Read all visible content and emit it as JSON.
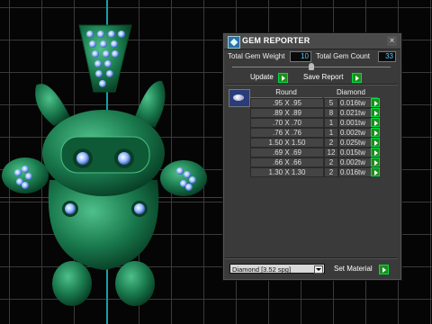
{
  "panel": {
    "title": "GEM REPORTER",
    "close_glyph": "×",
    "total_weight_label": "Total Gem Weight",
    "total_weight_value": "10",
    "total_count_label": "Total Gem Count",
    "total_count_value": "33",
    "update_label": "Update",
    "save_report_label": "Save Report",
    "slider_level": 0.5,
    "table": {
      "headers": [
        "Round",
        "Diamond"
      ],
      "rows": [
        {
          "size": ".95 X .95",
          "count": "5",
          "tw": "0.016tw"
        },
        {
          "size": ".89 X .89",
          "count": "8",
          "tw": "0.021tw"
        },
        {
          "size": ".70 X .70",
          "count": "1",
          "tw": "0.001tw"
        },
        {
          "size": ".76 X .76",
          "count": "1",
          "tw": "0.002tw"
        },
        {
          "size": "1.50 X 1.50",
          "count": "2",
          "tw": "0.025tw"
        },
        {
          "size": ".69 X .69",
          "count": "12",
          "tw": "0.015tw"
        },
        {
          "size": ".66 X .66",
          "count": "2",
          "tw": "0.002tw"
        },
        {
          "size": "1.30 X 1.30",
          "count": "2",
          "tw": "0.016tw"
        }
      ]
    },
    "material_select": "Diamond     [3.52 spg]",
    "set_material_label": "Set Material"
  },
  "colors": {
    "accent_go": "#1c8f1c",
    "value_text": "#55ccff",
    "model_green": "#1f8a5c",
    "axis_cyan": "#13a0a6",
    "axis_red": "#b01010"
  },
  "icons": {
    "title": "gem-reporter-icon",
    "close": "close-icon",
    "go": "green-arrow-icon",
    "gem": "round-gem-icon",
    "dropdown": "chevron-down-icon"
  }
}
